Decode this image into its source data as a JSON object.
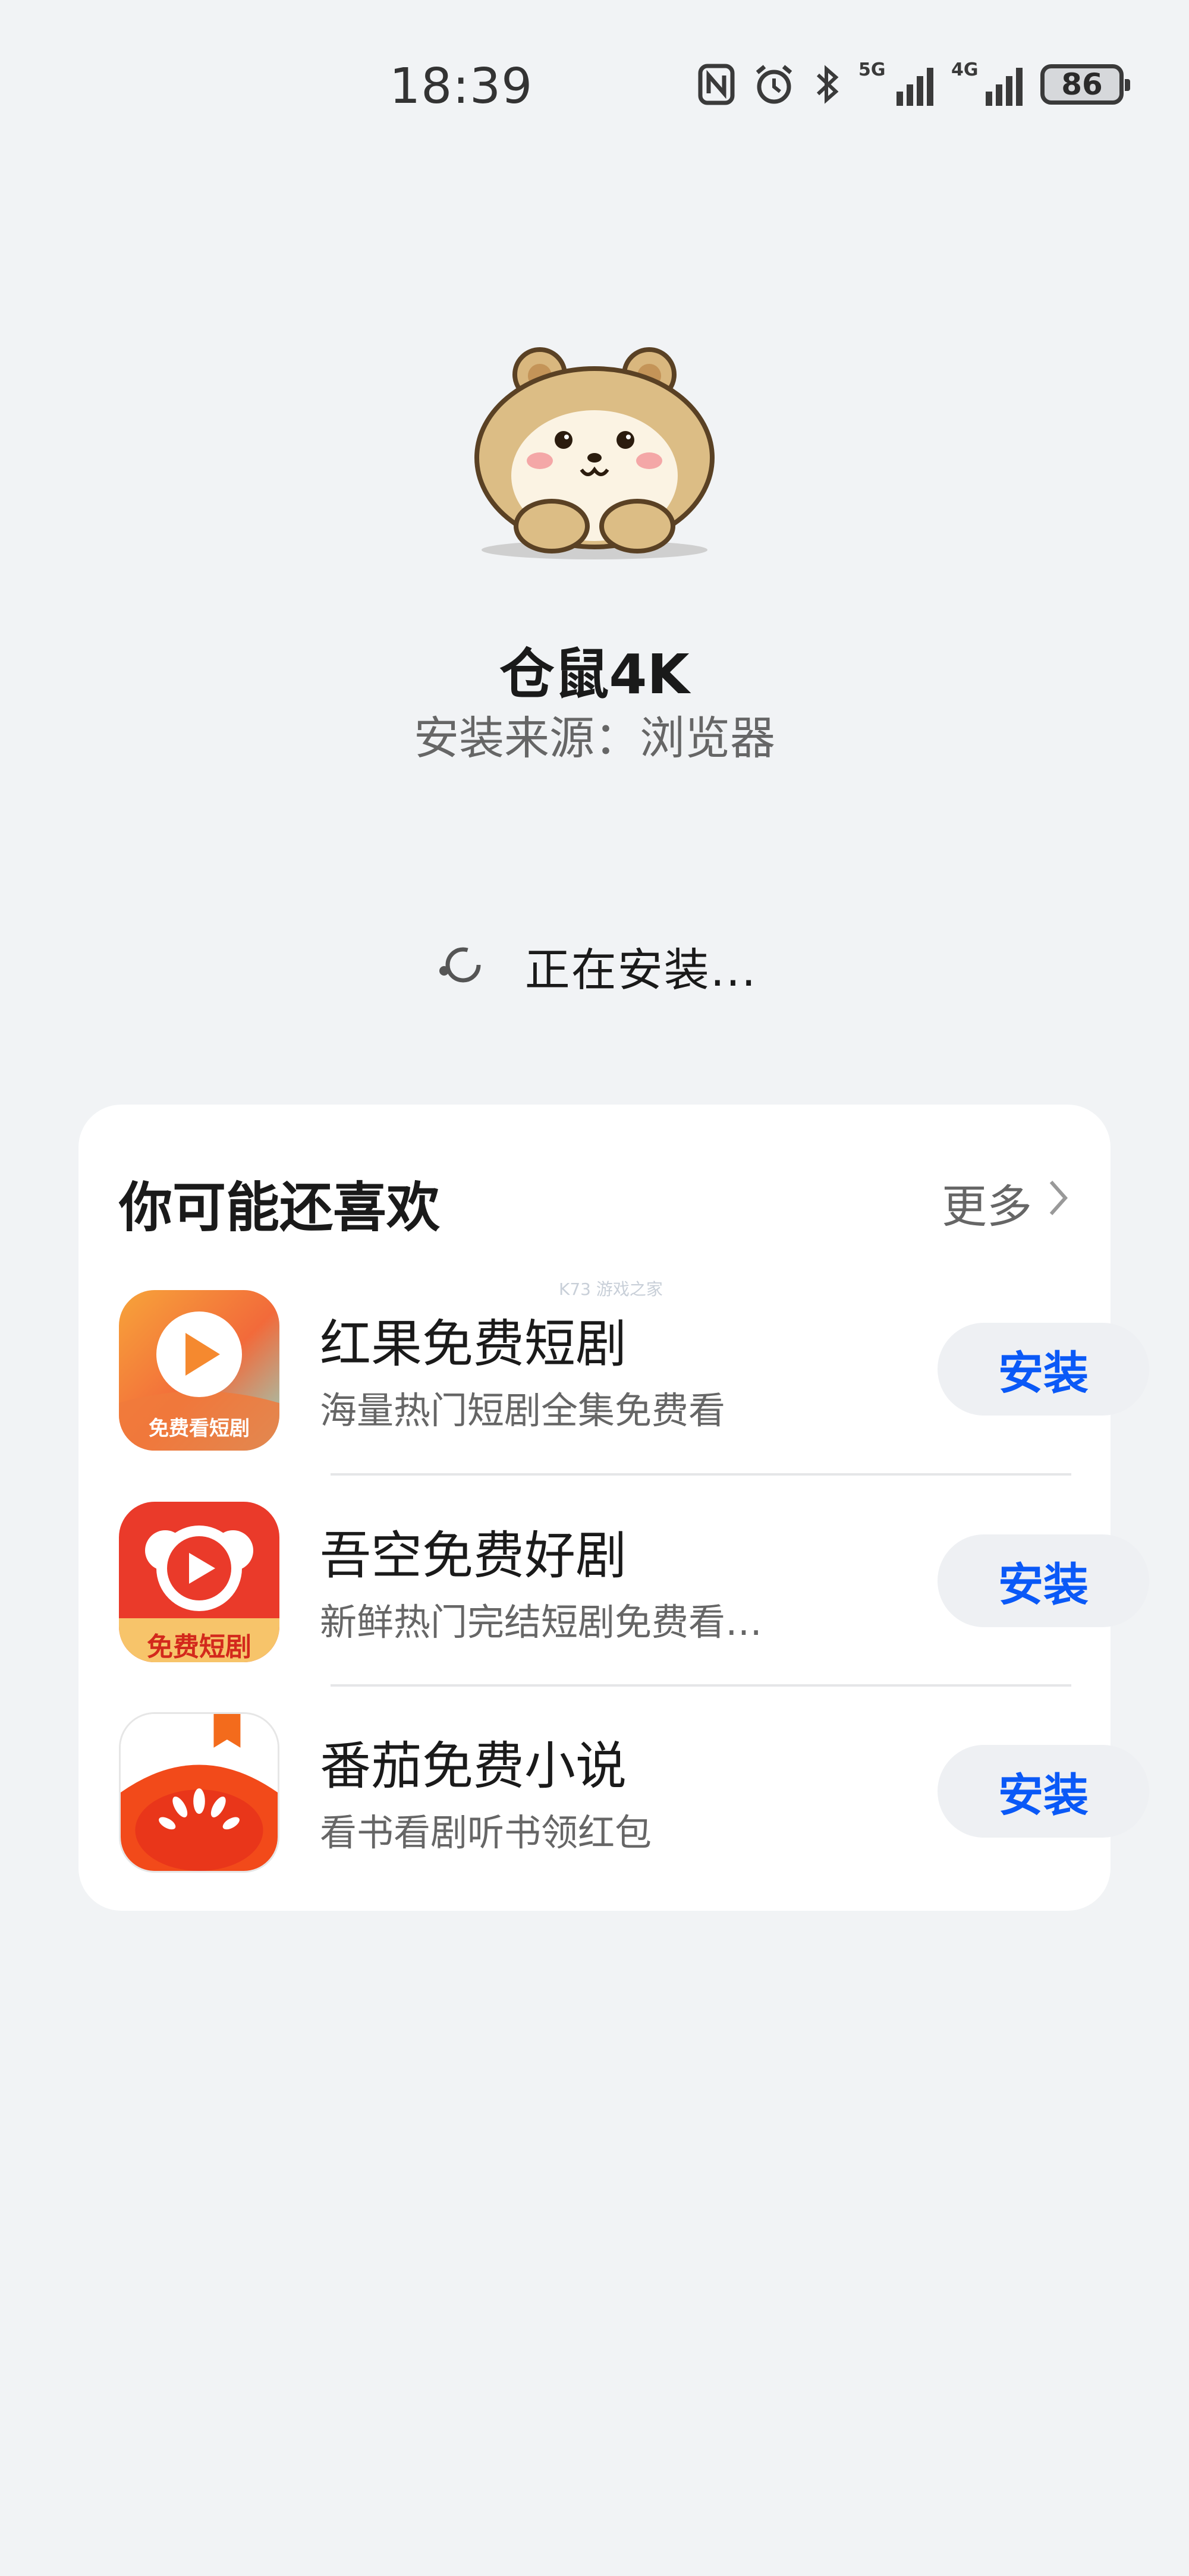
{
  "status_bar": {
    "time": "18:39",
    "network_5g": "5G",
    "network_4g": "4G",
    "battery": "86",
    "icons": [
      "nfc-icon",
      "alarm-icon",
      "bluetooth-icon",
      "signal-5g-icon",
      "signal-4g-icon",
      "battery-icon"
    ]
  },
  "app": {
    "icon": "hamster-icon",
    "name": "仓鼠4K",
    "source": "安装来源：浏览器"
  },
  "install_status": {
    "text": "正在安装..."
  },
  "recommendations": {
    "title": "你可能还喜欢",
    "more_label": "更多",
    "watermark": "K73 游戏之家",
    "items": [
      {
        "name": "红果免费短剧",
        "description": "海量热门短剧全集免费看",
        "icon": "hongguo-play-icon",
        "icon_label": "免费看短剧",
        "button": "安装"
      },
      {
        "name": "吾空免费好剧",
        "description": "新鲜热门完结短剧免费看…",
        "icon": "wukong-monkey-icon",
        "icon_label": "免费短剧",
        "button": "安装"
      },
      {
        "name": "番茄免费小说",
        "description": "看书看剧听书领红包",
        "icon": "fanqie-tomato-icon",
        "button": "安装"
      }
    ]
  },
  "colors": {
    "background": "#f1f3f5",
    "card": "#ffffff",
    "accent_blue": "#0a59f7",
    "button_bg": "#eef0f3"
  }
}
